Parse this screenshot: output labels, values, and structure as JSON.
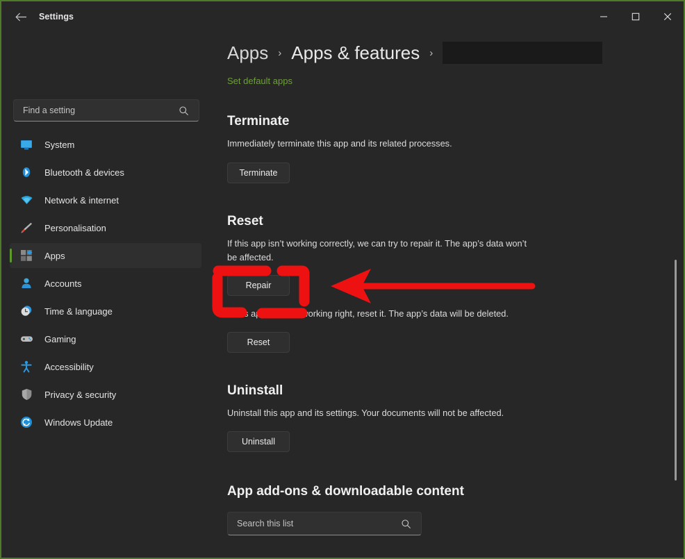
{
  "window": {
    "title": "Settings",
    "back_icon": "back-arrow-icon",
    "minimize_label": "─",
    "maximize_label": "□",
    "close_label": "✕",
    "border_color": "#4f7a2a"
  },
  "sidebar": {
    "search": {
      "placeholder": "Find a setting",
      "value": "",
      "icon": "search-icon"
    },
    "items": [
      {
        "label": "System",
        "icon": "monitor-icon",
        "selected": false
      },
      {
        "label": "Bluetooth & devices",
        "icon": "bluetooth-icon",
        "selected": false
      },
      {
        "label": "Network & internet",
        "icon": "wifi-icon",
        "selected": false
      },
      {
        "label": "Personalisation",
        "icon": "paintbrush-icon",
        "selected": false
      },
      {
        "label": "Apps",
        "icon": "apps-grid-icon",
        "selected": true
      },
      {
        "label": "Accounts",
        "icon": "account-person-icon",
        "selected": false
      },
      {
        "label": "Time & language",
        "icon": "clock-icon",
        "selected": false
      },
      {
        "label": "Gaming",
        "icon": "gamepad-icon",
        "selected": false
      },
      {
        "label": "Accessibility",
        "icon": "accessibility-person-icon",
        "selected": false
      },
      {
        "label": "Privacy & security",
        "icon": "shield-icon",
        "selected": false
      },
      {
        "label": "Windows Update",
        "icon": "update-refresh-icon",
        "selected": false
      }
    ],
    "accent_color": "#5c9a2e"
  },
  "breadcrumb": {
    "root": "Apps",
    "separator": "›",
    "level2": "Apps & features",
    "separator2": "›",
    "redacted": ""
  },
  "main": {
    "default_apps_link": "Set default apps",
    "sections": [
      {
        "title": "Terminate",
        "description": "Immediately terminate this app and its related processes.",
        "button": "Terminate"
      },
      {
        "title": "Reset",
        "description": "If this app isn’t working correctly, we can try to repair it. The app’s data won’t be affected.",
        "button": "Repair",
        "description2": "If this app still isn’t working right, reset it. The app’s data will be deleted.",
        "button2": "Reset"
      },
      {
        "title": "Uninstall",
        "description": "Uninstall this app and its settings. Your documents will not be affected.",
        "button": "Uninstall"
      },
      {
        "title": "App add-ons & downloadable content",
        "search_placeholder": "Search this list",
        "search_value": ""
      }
    ]
  },
  "annotations": {
    "highlight_color": "#ee1111",
    "target": "Repair"
  }
}
